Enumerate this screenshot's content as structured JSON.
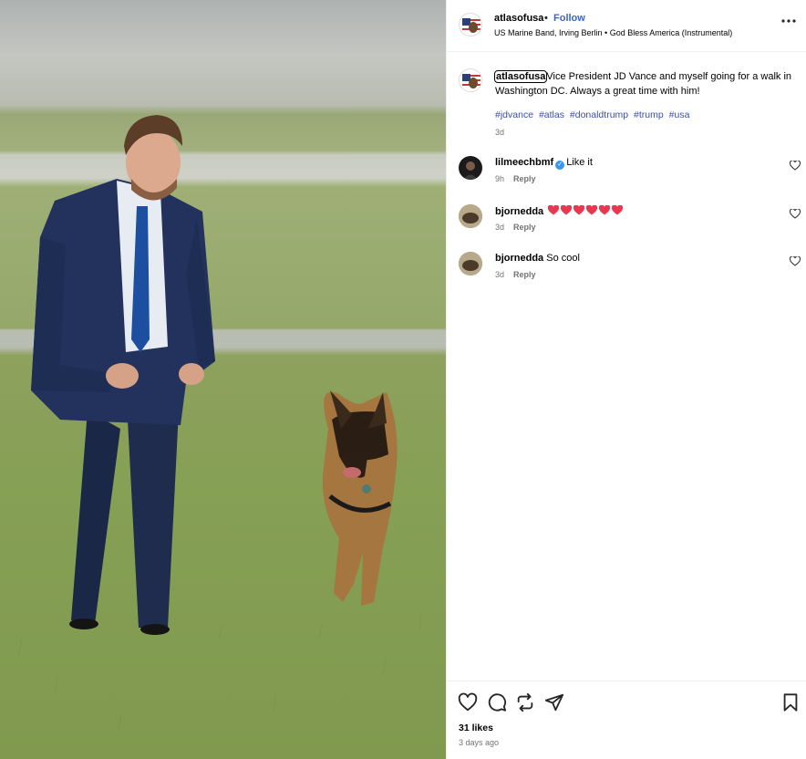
{
  "post": {
    "author": "atlasofusa",
    "follow_label": "Follow",
    "separator": "•",
    "music": "US Marine Band, Irving Berlin • God Bless America (Instrumental)",
    "caption_user": "atlasofusa",
    "caption_text": "Vice President JD Vance and myself going for a walk in Washington DC. Always a great time with him!",
    "hashtags": [
      "#jdvance",
      "#atlas",
      "#donaldtrump",
      "#trump",
      "#usa"
    ],
    "caption_time": "3d",
    "likes": "31 likes",
    "posted": "3 days ago"
  },
  "comments": [
    {
      "user": "lilmeechbmf",
      "verified": true,
      "text": "Like it",
      "time": "9h",
      "reply": "Reply"
    },
    {
      "user": "bjornedda",
      "verified": false,
      "text": "",
      "hearts": 6,
      "time": "3d",
      "reply": "Reply"
    },
    {
      "user": "bjornedda",
      "verified": false,
      "text": "So cool",
      "time": "3d",
      "reply": "Reply"
    }
  ],
  "icons": {
    "more": "more-horizontal-icon",
    "like": "heart-outline-icon",
    "comment": "comment-bubble-icon",
    "repost": "repost-icon",
    "share": "paper-plane-icon",
    "save": "bookmark-icon",
    "heart_emoji": "red-heart-emoji"
  },
  "colors": {
    "link": "#3b4ea8",
    "follow": "#3b66c4",
    "muted": "#737373",
    "heart": "#e8384f",
    "verified": "#3897f0"
  }
}
